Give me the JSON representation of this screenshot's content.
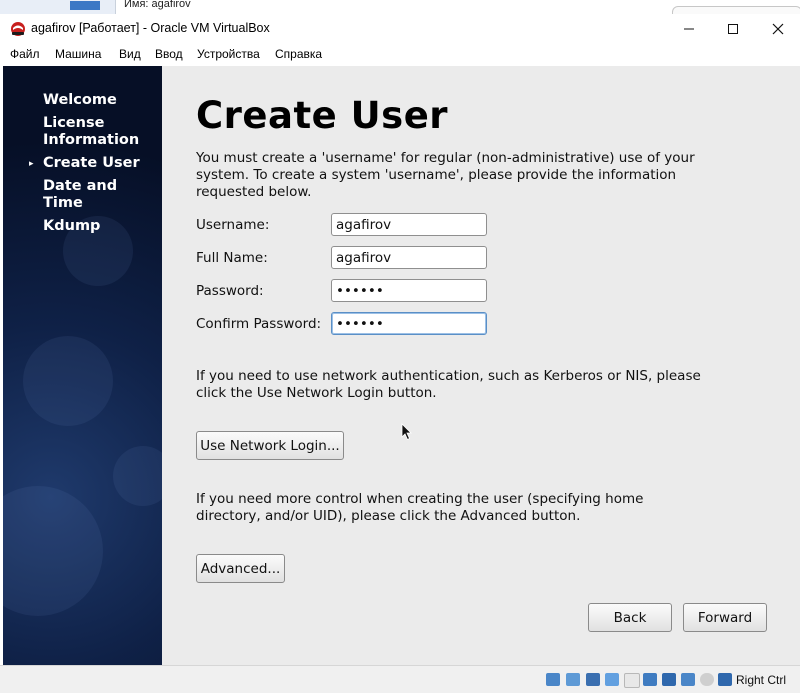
{
  "host": {
    "label": "Имя:   agafirov"
  },
  "window": {
    "title": "agafirov [Работает] - Oracle VM VirtualBox",
    "menu": [
      "Файл",
      "Машина",
      "Вид",
      "Ввод",
      "Устройства",
      "Справка"
    ]
  },
  "sidebar": {
    "steps": [
      "Welcome",
      "License Information",
      "Create User",
      "Date and Time",
      "Kdump"
    ],
    "current": "Create User"
  },
  "page": {
    "title": "Create User",
    "intro": "You must create a 'username' for regular (non-administrative) use of your system.  To create a system 'username', please provide the information requested below.",
    "fields": {
      "username_label": "Username:",
      "username_value": "agafirov",
      "fullname_label": "Full Name:",
      "fullname_value": "agafirov",
      "password_label": "Password:",
      "password_value": "••••••",
      "confirm_label": "Confirm Password:",
      "confirm_value": "••••••"
    },
    "network_text": "If you need to use network authentication, such as Kerberos or NIS, please click the Use Network Login button.",
    "network_button": "Use Network Login...",
    "advanced_text": "If you need more control when creating the user (specifying home directory, and/or UID), please click the Advanced button.",
    "advanced_button": "Advanced...",
    "back_button": "Back",
    "forward_button": "Forward"
  },
  "statusbar": {
    "host_key": "Right Ctrl"
  },
  "colors": {
    "sidebar_bg": "#0f2147",
    "content_bg": "#ebebeb",
    "accent": "#3b78c5"
  }
}
